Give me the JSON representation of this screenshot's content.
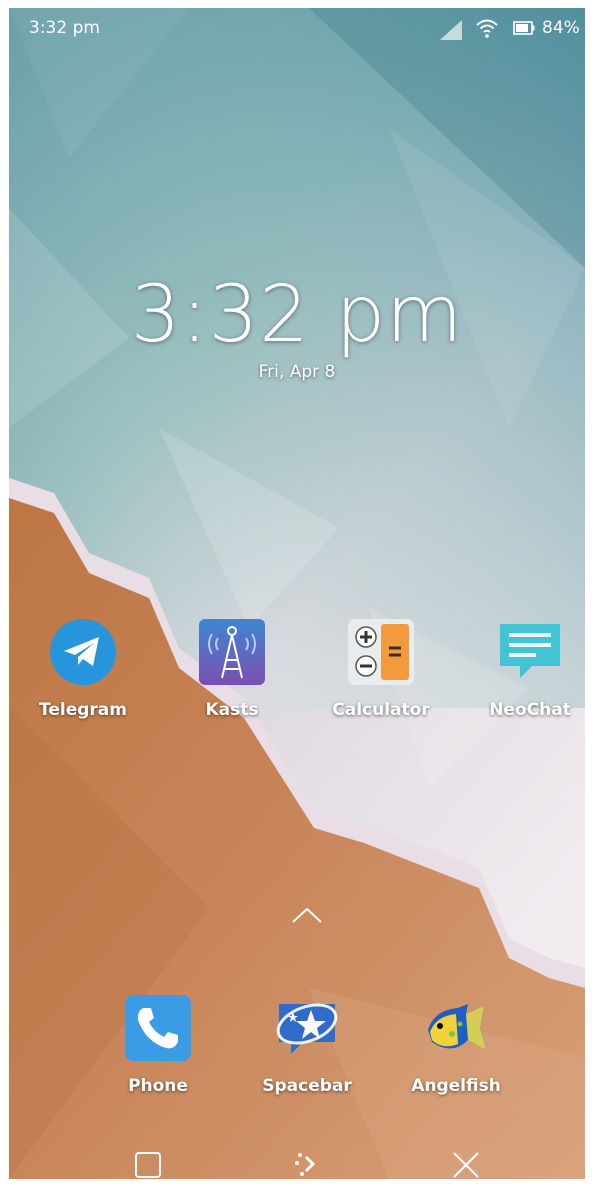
{
  "status_bar": {
    "time": "3:32 pm",
    "battery_percent": "84%",
    "icons": [
      "signal-icon",
      "wifi-icon",
      "battery-icon"
    ]
  },
  "lockscreen": {
    "clock": "3:32 pm",
    "date": "Fri, Apr 8"
  },
  "favorites": [
    {
      "label": "Telegram",
      "icon": "telegram-icon"
    },
    {
      "label": "Kasts",
      "icon": "kasts-icon"
    },
    {
      "label": "Calculator",
      "icon": "calculator-icon"
    },
    {
      "label": "NeoChat",
      "icon": "neochat-icon"
    }
  ],
  "dock": [
    {
      "label": "Phone",
      "icon": "phone-icon"
    },
    {
      "label": "Spacebar",
      "icon": "spacebar-icon"
    },
    {
      "label": "Angelfish",
      "icon": "angelfish-icon"
    }
  ],
  "app_drawer_handle": "chevron-up-icon",
  "navbar": [
    "task-switcher-icon",
    "home-icon",
    "close-icon"
  ],
  "colors": {
    "sea_top": "#4a8a9a",
    "foam": "#f1e9ee",
    "sand": "#c6804f",
    "label": "#ffffff"
  }
}
